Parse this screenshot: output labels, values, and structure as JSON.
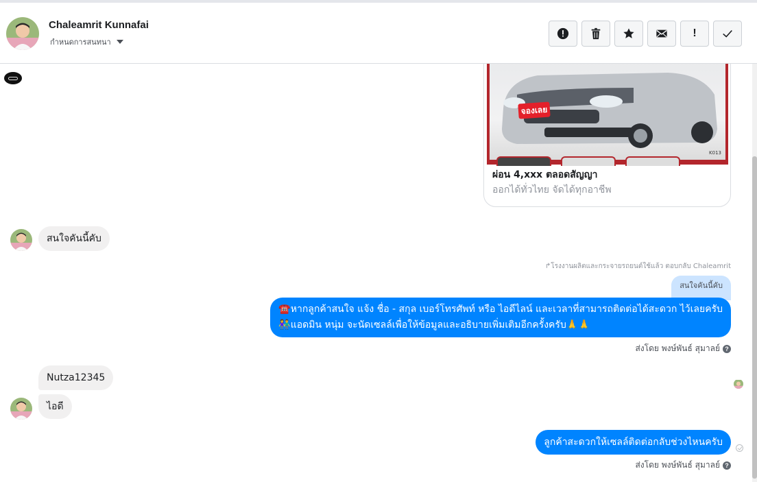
{
  "header": {
    "contact_name": "Chaleamrit Kunnafai",
    "assign_label": "กำหนดการสนทนา"
  },
  "toolbar": {
    "icons": [
      "alert-circle-icon",
      "trash-icon",
      "star-icon",
      "envelope-icon",
      "exclamation-icon",
      "check-icon"
    ],
    "exclamation_label": "!"
  },
  "card": {
    "badge": "จองเลย",
    "code": "K013",
    "title": "ผ่อน 4,xxx ตลอดสัญญา",
    "subtitle": "ออกได้ทั่วไทย จัดได้ทุกอาชีพ"
  },
  "messages": {
    "m1": "สนใจคันนี้คับ",
    "reply_meta": "↱โรงงานผลิตและกระจายรถยนต์ใช้แล้ว ตอบกลับ Chaleamrit",
    "reply_quote": "สนใจคันนี้คับ",
    "m2_line1": "☎️หากลูกค้าสนใจ แจ้ง ชื่อ - สกุล เบอร์โทรศัพท์ หรือ ไอดีไลน์ และเวลาที่สามารถติดต่อได้สะดวก ไว้เลยครับ",
    "m2_line2": "👫แอดมิน หนุ่ม จะนัดเซลล์เพื่อให้ข้อมูลและอธิบายเพิ่มเติมอีกครั้งครับ🙏🙏",
    "sent_by_1": "ส่งโดย พงษ์พันธ์ สุมาลย์",
    "m3": "Nutza12345",
    "m4": "ไอดี",
    "m5": "ลูกค้าสะดวกให้เซลล์ติดต่อกลับช่วงไหนครับ",
    "sent_by_2": "ส่งโดย พงษ์พันธ์ สุมาลย์"
  },
  "colors": {
    "outgoing": "#0084ff",
    "incoming": "#f1f0f0",
    "quote": "#cce4ff"
  }
}
